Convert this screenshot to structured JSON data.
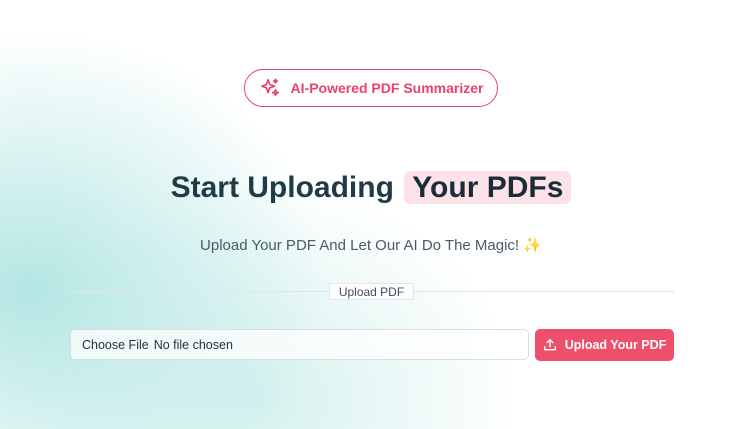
{
  "badge": {
    "label": "AI-Powered PDF Summarizer",
    "icon": "sparkles-icon"
  },
  "hero": {
    "title_main": "Start Uploading",
    "title_highlight": "Your PDFs",
    "subtitle": "Upload Your PDF And Let Our AI Do The Magic! ✨"
  },
  "divider": {
    "label": "Upload PDF"
  },
  "upload": {
    "choose_file_label": "Choose File",
    "file_status": "No file chosen",
    "button_label": "Upload Your PDF",
    "button_icon": "upload-icon"
  },
  "colors": {
    "accent": "#e8436c",
    "button": "#ee4f6c",
    "highlight_bg": "#fde3e8",
    "title": "#1f3b46"
  }
}
